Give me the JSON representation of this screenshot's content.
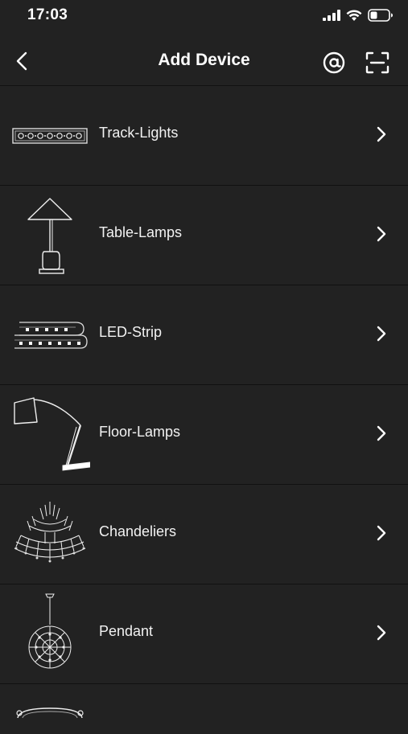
{
  "status_bar": {
    "time": "17:03",
    "icons": [
      "cellular-signal-icon",
      "wifi-icon",
      "battery-icon"
    ]
  },
  "header": {
    "title": "Add Device",
    "back_icon": "chevron-left-icon",
    "actions": [
      "at-sign-icon",
      "scan-icon"
    ]
  },
  "devices": [
    {
      "label": "Track-Lights",
      "icon": "track-lights-icon"
    },
    {
      "label": "Table-Lamps",
      "icon": "table-lamp-icon"
    },
    {
      "label": "LED-Strip",
      "icon": "led-strip-icon"
    },
    {
      "label": "Floor-Lamps",
      "icon": "floor-lamp-icon"
    },
    {
      "label": "Chandeliers",
      "icon": "chandelier-icon"
    },
    {
      "label": "Pendant",
      "icon": "pendant-icon"
    }
  ],
  "colors": {
    "background": "#222222",
    "divider": "#111111",
    "text": "#ffffff"
  }
}
